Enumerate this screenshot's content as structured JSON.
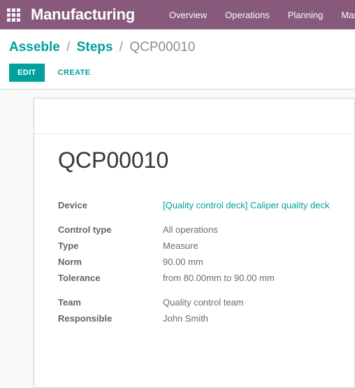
{
  "navbar": {
    "apps_icon": "apps-grid-icon",
    "brand": "Manufacturing",
    "menu_items": [
      {
        "label": "Overview"
      },
      {
        "label": "Operations"
      },
      {
        "label": "Planning"
      },
      {
        "label": "Maste"
      }
    ],
    "background_color": "#875A7B"
  },
  "control_panel": {
    "breadcrumb": {
      "items": [
        {
          "label": "Asseble",
          "type": "link"
        },
        {
          "label": "Steps",
          "type": "link"
        },
        {
          "label": "QCP00010",
          "type": "current"
        }
      ],
      "separator": "/"
    },
    "buttons": {
      "edit_label": "EDIT",
      "create_label": "CREATE"
    },
    "accent_color": "#00A09D"
  },
  "record": {
    "title": "QCP00010",
    "groups": [
      {
        "fields": [
          {
            "label": "Device",
            "value": "[Quality control deck] Caliper quality deck",
            "is_link": true
          }
        ]
      },
      {
        "fields": [
          {
            "label": "Control type",
            "value": "All operations",
            "is_link": false
          },
          {
            "label": "Type",
            "value": "Measure",
            "is_link": false
          },
          {
            "label": "Norm",
            "value": "90.00 mm",
            "is_link": false
          },
          {
            "label": "Tolerance",
            "value": "from 80.00mm to 90.00 mm",
            "is_link": false
          }
        ]
      },
      {
        "fields": [
          {
            "label": "Team",
            "value": "Quality control team",
            "is_link": false
          },
          {
            "label": "Responsible",
            "value": "John Smith",
            "is_link": false
          }
        ]
      }
    ]
  }
}
